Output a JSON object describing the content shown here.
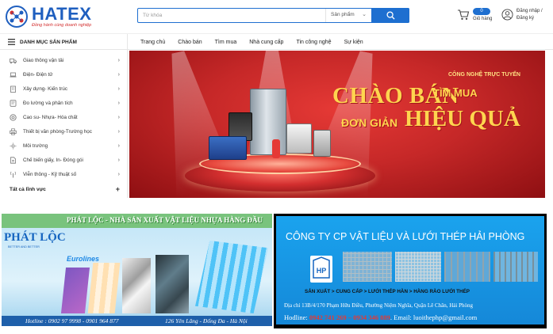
{
  "header": {
    "logo_text": "HATEX",
    "logo_slogan": "Đồng hành cùng doanh nghiệp",
    "search": {
      "placeholder": "Từ khóa",
      "category": "Sản phẩm"
    },
    "cart": {
      "count": "0",
      "label": "Giỏ hàng"
    },
    "user": {
      "login": "Đăng nhập /",
      "register": "Đăng ký"
    }
  },
  "navbar": {
    "categories_label": "DANH MỤC SẢN PHẨM",
    "items": [
      "Trang chủ",
      "Chào bán",
      "Tìm mua",
      "Nhà cung cấp",
      "Tin công nghệ",
      "Sự kiện"
    ]
  },
  "sidebar": {
    "items": [
      {
        "label": "Giao thông vận tải",
        "icon": "truck-icon"
      },
      {
        "label": "Điện- Điện tử",
        "icon": "laptop-icon"
      },
      {
        "label": "Xây dựng- Kiến trúc",
        "icon": "building-icon"
      },
      {
        "label": "Đo lường và phân tích",
        "icon": "meter-icon"
      },
      {
        "label": "Cao su- Nhựa- Hóa chất",
        "icon": "tire-icon"
      },
      {
        "label": "Thiết bị văn phòng-Trường học",
        "icon": "printer-icon"
      },
      {
        "label": "Môi trường",
        "icon": "leaf-icon"
      },
      {
        "label": "Chế biến giấy, In- Đóng gói",
        "icon": "paper-icon"
      },
      {
        "label": "Viễn thông - Kỹ thuật số",
        "icon": "antenna-icon"
      }
    ],
    "all_label": "Tất cả lĩnh vực"
  },
  "hero": {
    "small": "CÔNG NGHỆ TRỰC TUYẾN",
    "big1": "CHÀO BÁN",
    "big2": "TÌM MUA",
    "big3": "ĐƠN GIẢN",
    "big4": "HIỆU QUẢ"
  },
  "banner_left": {
    "title": "PHÁT LỘC - NHÀ SẢN XUẤT VẬT LIỆU NHỰA HÀNG ĐẦU",
    "logo": "PHÁT LỘC",
    "logo_sub": "BETTER AND BETTER",
    "brand": "Eurolines",
    "hotline": "Hotline : 0902 97 9998 - 0901 964 877",
    "address": "126 Yên Lãng - Đống Đa - Hà Nội"
  },
  "banner_right": {
    "title": "CÔNG TY CP VẬT LIỆU VÀ LƯỚI THÉP HẢI PHÒNG",
    "services": "SẢN XUẤT > CUNG CẤP > LƯỚI THÉP HÀN > HÀNG RÀO LƯỚI THÉP",
    "address": "Địa chỉ 13B/4/170 Phạm Hữu Điều, Phường Niệm Nghĩa, Quận Lê Chân, Hải Phòng",
    "hotline_label": "Hodline:",
    "hotline_numbers": "0942 741 269 – 0934 346 889",
    "email": "Email: luoithephp@gmail.com"
  },
  "colors": {
    "brand_blue": "#1e6fd0",
    "hero_red": "#c62828",
    "hero_gold": "#ffd54f"
  }
}
